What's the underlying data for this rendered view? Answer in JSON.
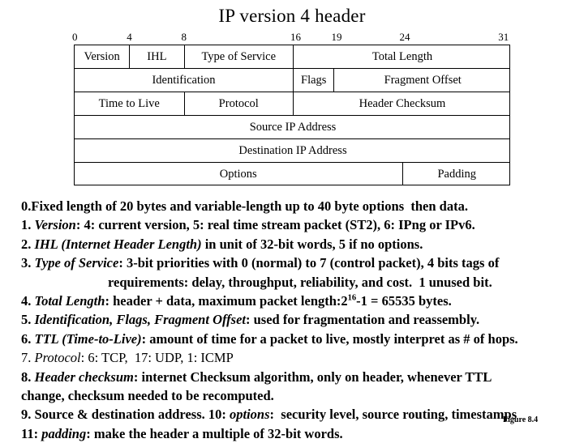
{
  "title": "IP version 4 header",
  "ruler": {
    "ticks": [
      {
        "label": "0",
        "bit": 0
      },
      {
        "label": "4",
        "bit": 4
      },
      {
        "label": "8",
        "bit": 8
      },
      {
        "label": "16",
        "bit": 16
      },
      {
        "label": "19",
        "bit": 19
      },
      {
        "label": "24",
        "bit": 24
      },
      {
        "label": "31",
        "bit": 31
      }
    ]
  },
  "diagram": {
    "rows": [
      {
        "cells": [
          {
            "label": "Version",
            "start": 0,
            "end": 4
          },
          {
            "label": "IHL",
            "start": 4,
            "end": 8
          },
          {
            "label": "Type of Service",
            "start": 8,
            "end": 16
          },
          {
            "label": "Total Length",
            "start": 16,
            "end": 32
          }
        ]
      },
      {
        "cells": [
          {
            "label": "Identification",
            "start": 0,
            "end": 16
          },
          {
            "label": "Flags",
            "start": 16,
            "end": 19
          },
          {
            "label": "Fragment Offset",
            "start": 19,
            "end": 32
          }
        ]
      },
      {
        "cells": [
          {
            "label": "Time to Live",
            "start": 0,
            "end": 8
          },
          {
            "label": "Protocol",
            "start": 8,
            "end": 16
          },
          {
            "label": "Header Checksum",
            "start": 16,
            "end": 32
          }
        ]
      },
      {
        "cells": [
          {
            "label": "Source IP Address",
            "start": 0,
            "end": 32
          }
        ]
      },
      {
        "cells": [
          {
            "label": "Destination IP Address",
            "start": 0,
            "end": 32
          }
        ]
      },
      {
        "cells": [
          {
            "label": "Options",
            "start": 0,
            "end": 24
          },
          {
            "label": "Padding",
            "start": 24,
            "end": 32
          }
        ]
      }
    ]
  },
  "notes": [
    {
      "id": "note-0",
      "html": "0.Fixed length of 20 bytes and variable-length up to 40 byte options&nbsp; then data."
    },
    {
      "id": "note-1",
      "html": "1. <i>Version</i>: 4: current version, 5: real time stream packet (ST2), 6: IPng or IPv6."
    },
    {
      "id": "note-2",
      "html": "2. <i>IHL (Internet Header Length)</i> in unit of 32-bit words, 5 if no options."
    },
    {
      "id": "note-3",
      "html": "3. <i>Type of Service</i>: 3-bit priorities with 0 (normal) to 7 (control packet), 4 bits tags of"
    },
    {
      "id": "note-3b",
      "html": "requirements: delay, throughput, reliability, and cost.&nbsp; 1 unused bit.",
      "indent": true
    },
    {
      "id": "note-4",
      "html": "4. <i>Total Length</i>: header + data, maximum packet length:2<sup>16</sup>-1 = 65535 bytes."
    },
    {
      "id": "note-5",
      "html": "5. <i>Identification, Flags, Fragment Offset</i>: used for fragmentation and reassembly."
    },
    {
      "id": "note-6",
      "html": "6. <i>TTL (Time-to-Live)</i>: amount of time for a packet to live, mostly interpret as # of hops."
    },
    {
      "id": "note-7",
      "html": "<span class=\"thin\">7. <i>Protocol</i>: 6: TCP,&nbsp; 17: UDP, 1: ICMP</span>"
    },
    {
      "id": "note-8",
      "html": "8. <i>Header checksum</i>: internet Checksum algorithm, only on header, whenever TTL"
    },
    {
      "id": "note-8b",
      "html": "change, checksum needed to be recomputed."
    },
    {
      "id": "note-9",
      "html": "9. Source &amp; destination address. 10: <i>options</i>:&nbsp; security level, source routing, timestamps"
    },
    {
      "id": "note-11",
      "html": "11: <i>padding</i>: make the header a multiple of 32-bit words."
    }
  ],
  "figure_caption": "Figure 8.4"
}
